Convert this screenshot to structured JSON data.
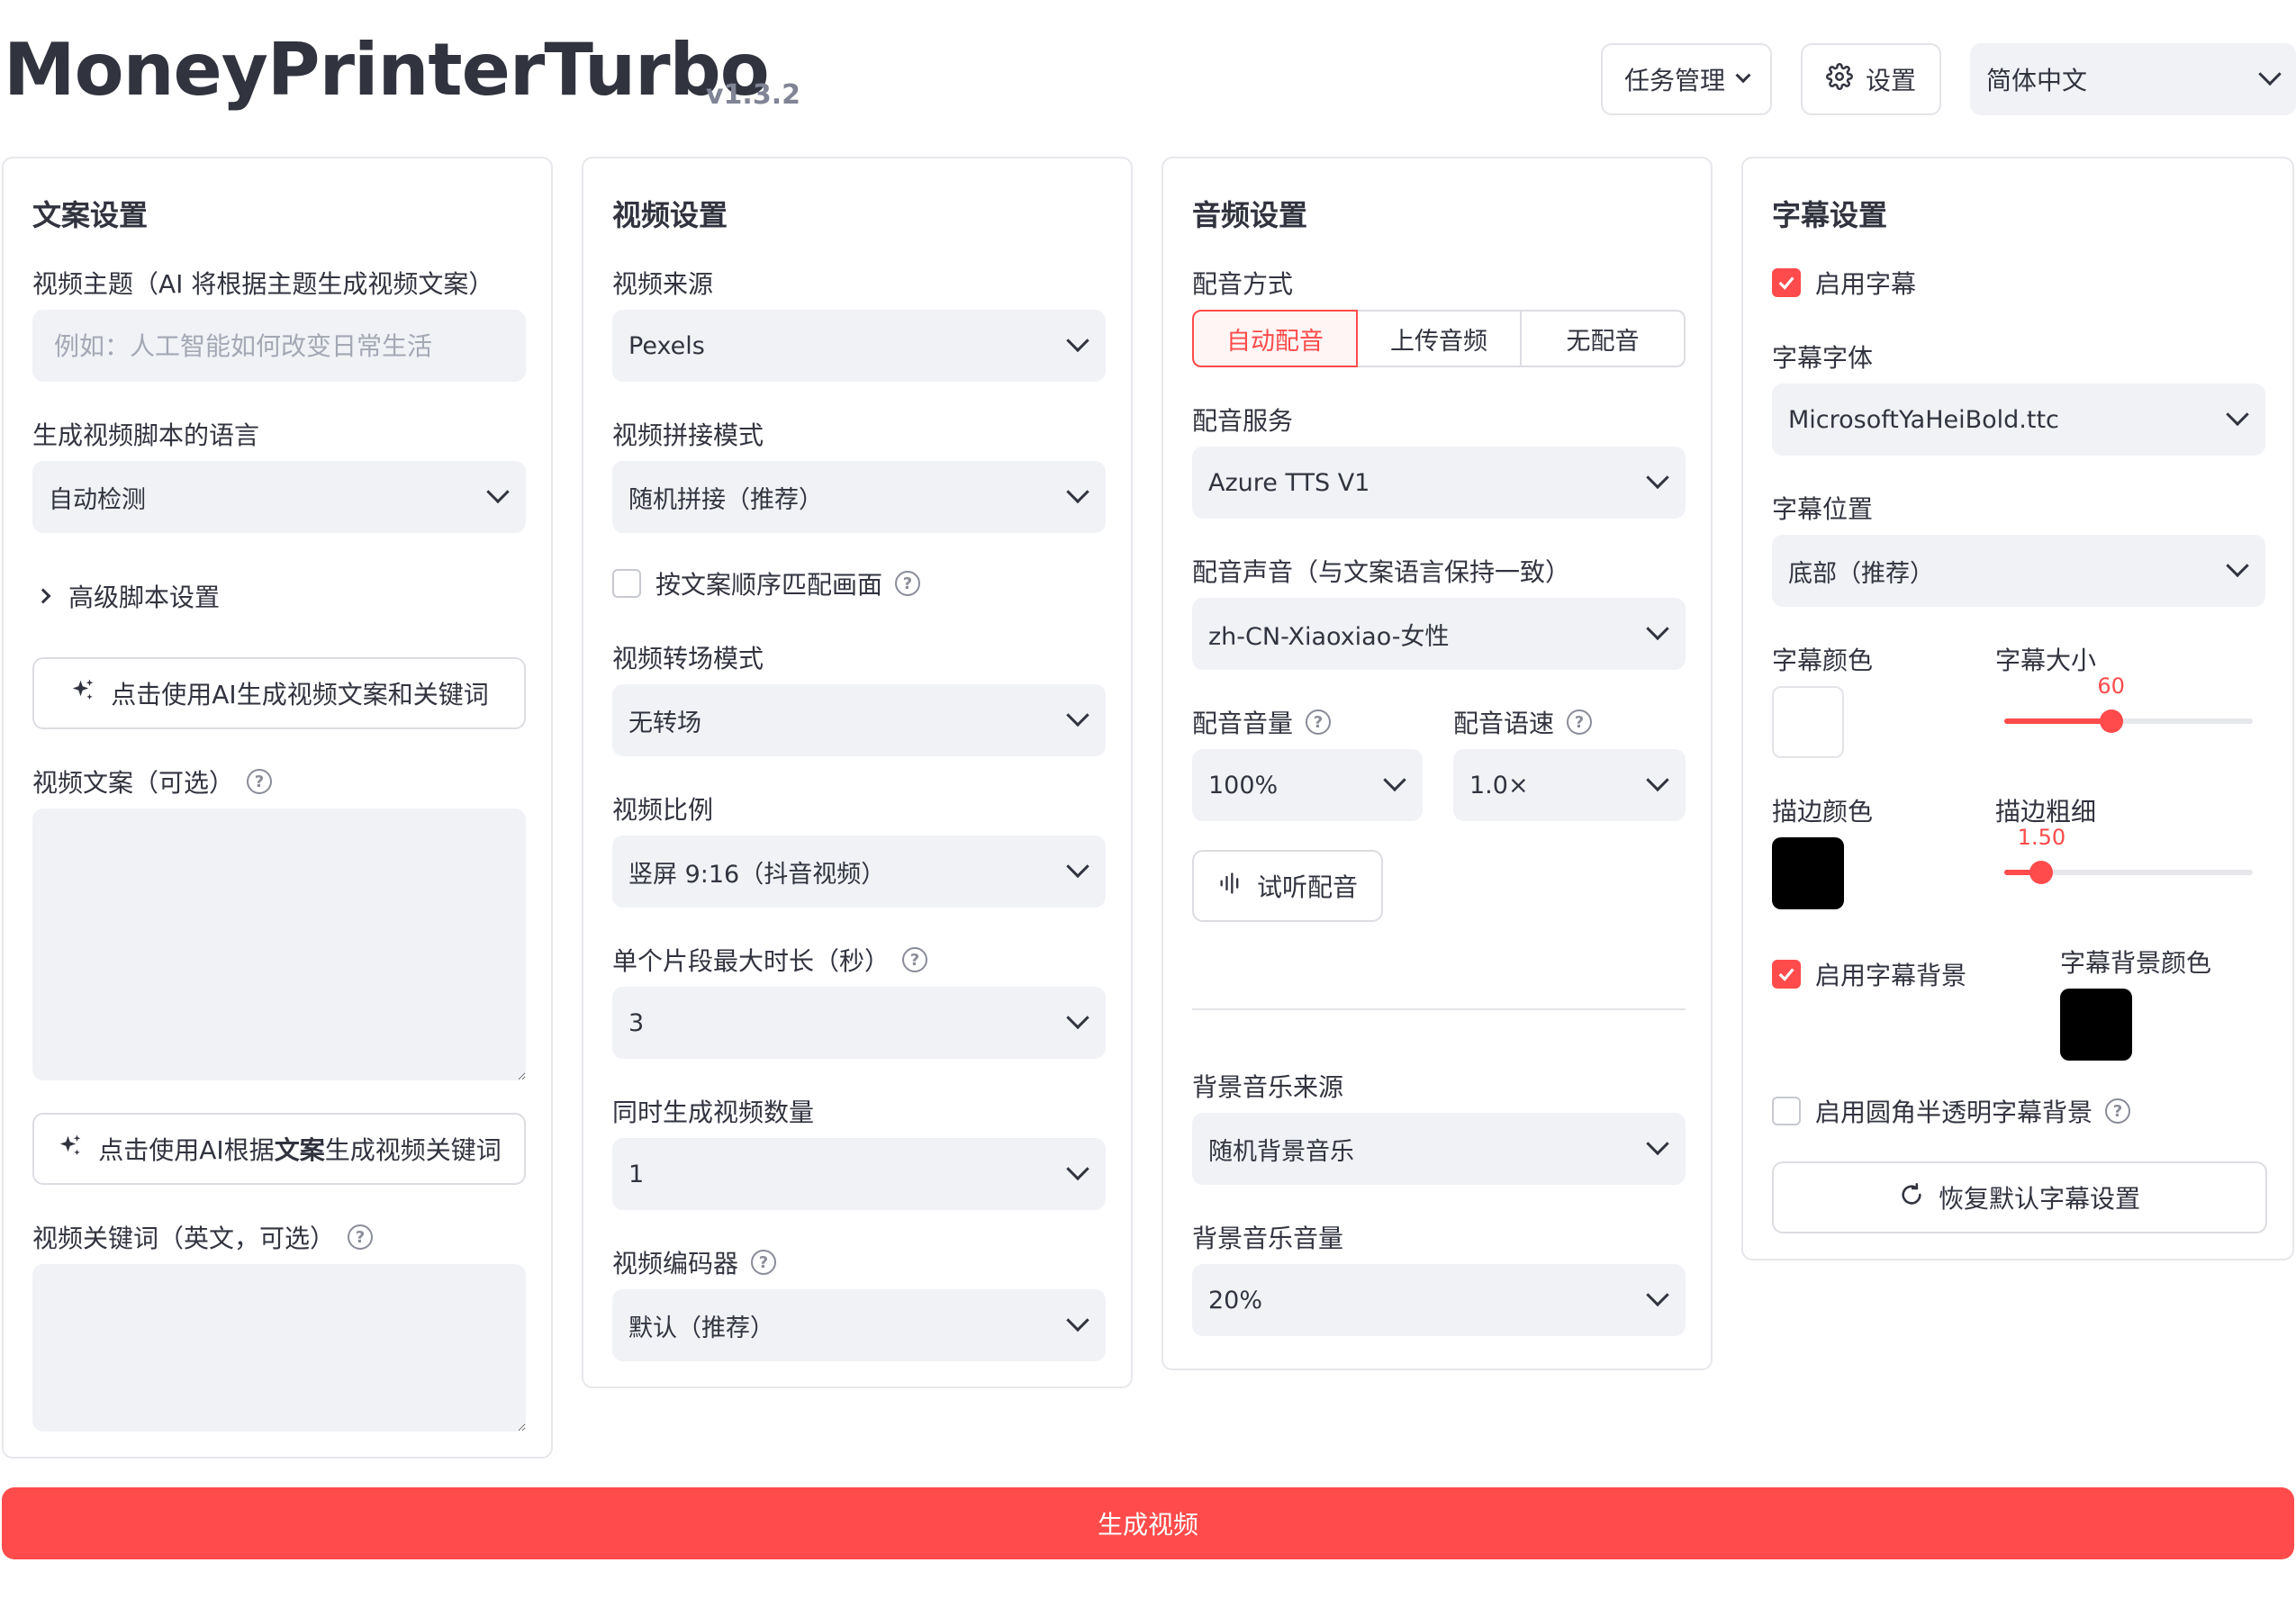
{
  "header": {
    "title": "MoneyPrinterTurbo",
    "version": "v1.3.2",
    "task_button": "任务管理",
    "settings_button": "设置",
    "language": "简体中文"
  },
  "script": {
    "title": "文案设置",
    "topic_label": "视频主题（AI 将根据主题生成视频文案）",
    "topic_placeholder": "例如：人工智能如何改变日常生活",
    "lang_label": "生成视频脚本的语言",
    "lang_value": "自动检测",
    "advanced": "高级脚本设置",
    "gen_button": "点击使用AI生成视频文案和关键词",
    "script_label": "视频文案（可选）",
    "kw_button_pre": "点击使用AI根据",
    "kw_button_bold": "文案",
    "kw_button_post": "生成视频关键词",
    "keywords_label": "视频关键词（英文，可选）"
  },
  "video": {
    "title": "视频设置",
    "source_label": "视频来源",
    "source_value": "Pexels",
    "concat_label": "视频拼接模式",
    "concat_value": "随机拼接（推荐）",
    "match_label": "按文案顺序匹配画面",
    "transition_label": "视频转场模式",
    "transition_value": "无转场",
    "ratio_label": "视频比例",
    "ratio_value": "竖屏 9:16（抖音视频）",
    "clip_label": "单个片段最大时长（秒）",
    "clip_value": "3",
    "count_label": "同时生成视频数量",
    "count_value": "1",
    "codec_label": "视频编码器",
    "codec_value": "默认（推荐）"
  },
  "audio": {
    "title": "音频设置",
    "mode_label": "配音方式",
    "modes": [
      "自动配音",
      "上传音频",
      "无配音"
    ],
    "service_label": "配音服务",
    "service_value": "Azure TTS V1",
    "voice_label": "配音声音（与文案语言保持一致）",
    "voice_value": "zh-CN-Xiaoxiao-女性",
    "volume_label": "配音音量",
    "volume_value": "100%",
    "rate_label": "配音语速",
    "rate_value": "1.0×",
    "preview_button": "试听配音",
    "bgm_label": "背景音乐来源",
    "bgm_value": "随机背景音乐",
    "bgm_volume_label": "背景音乐音量",
    "bgm_volume_value": "20%"
  },
  "subtitle": {
    "title": "字幕设置",
    "enable_label": "启用字幕",
    "font_label": "字幕字体",
    "font_value": "MicrosoftYaHeiBold.ttc",
    "position_label": "字幕位置",
    "position_value": "底部（推荐）",
    "color_label": "字幕颜色",
    "color_value": "#FFFFFF",
    "size_label": "字幕大小",
    "size_value": "60",
    "size_fraction": 0.43,
    "stroke_color_label": "描边颜色",
    "stroke_color_value": "#000000",
    "stroke_width_label": "描边粗细",
    "stroke_width_value": "1.50",
    "stroke_fraction": 0.15,
    "bg_enable_label": "启用字幕背景",
    "bg_color_label": "字幕背景颜色",
    "bg_color_value": "#000000",
    "rounded_label": "启用圆角半透明字幕背景",
    "reset_button": "恢复默认字幕设置"
  },
  "generate_button": "生成视频",
  "accent_color": "#FF4B4B"
}
